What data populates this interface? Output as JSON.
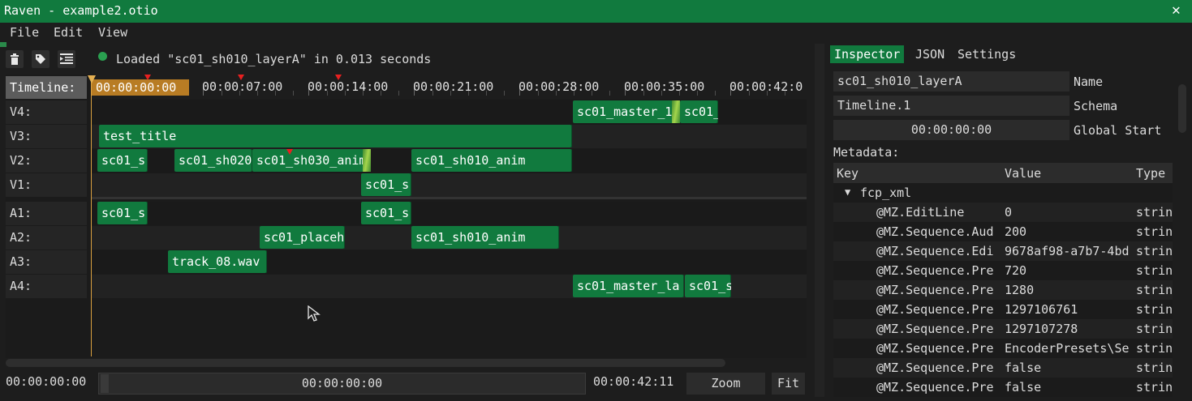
{
  "window": {
    "title": "Raven - example2.otio",
    "close_icon": "close-icon"
  },
  "menu": {
    "file": "File",
    "edit": "Edit",
    "view": "View"
  },
  "toolbar": {
    "delete_icon": "trash-icon",
    "tag_icon": "tag-icon",
    "indent_icon": "indent-icon",
    "status_message": "Loaded \"sc01_sh010_layerA\" in 0.013 seconds"
  },
  "timeline": {
    "label": "Timeline:",
    "current_time": "00:00:00:00",
    "ruler": [
      "00:00:07:00",
      "00:00:14:00",
      "00:00:21:00",
      "00:00:28:00",
      "00:00:35:00",
      "00:00:42:0"
    ],
    "tracks": [
      "V4:",
      "V3:",
      "V2:",
      "V1:",
      "A1:",
      "A2:",
      "A3:",
      "A4:"
    ],
    "clips": {
      "v4_1": "sc01_master_1",
      "v4_2": "sc01_",
      "v3_1": "test_title",
      "v2_1": "sc01_s",
      "v2_2": "sc01_sh020",
      "v2_3": "sc01_sh030_anim",
      "v2_4": "sc01_sh010_anim",
      "v1_1": "sc01_s",
      "a1_1": "sc01_s",
      "a1_2": "sc01_s",
      "a2_1": "sc01_placeh",
      "a2_2": "sc01_sh010_anim",
      "a3_1": "track_08.wav",
      "a4_1": "sc01_master_la",
      "a4_2": "sc01_s"
    }
  },
  "bottom_bar": {
    "start": "00:00:00:00",
    "slider": "00:00:00:00",
    "end": "00:00:42:11",
    "zoom": "Zoom",
    "fit": "Fit"
  },
  "inspector": {
    "tabs": [
      "Inspector",
      "JSON",
      "Settings"
    ],
    "fields": [
      {
        "value": "sc01_sh010_layerA",
        "label": "Name"
      },
      {
        "value": "Timeline.1",
        "label": "Schema"
      },
      {
        "value": "00:00:00:00",
        "label": "Global Start"
      }
    ],
    "metadata_label": "Metadata:",
    "columns": [
      "Key",
      "Value",
      "Type"
    ],
    "group": "fcp_xml",
    "rows": [
      {
        "key": "@MZ.EditLine",
        "value": "0",
        "type": "strin"
      },
      {
        "key": "@MZ.Sequence.Aud",
        "value": "200",
        "type": "strin"
      },
      {
        "key": "@MZ.Sequence.Edi",
        "value": "9678af98-a7b7-4bd",
        "type": "strin"
      },
      {
        "key": "@MZ.Sequence.Pre",
        "value": "720",
        "type": "strin"
      },
      {
        "key": "@MZ.Sequence.Pre",
        "value": "1280",
        "type": "strin"
      },
      {
        "key": "@MZ.Sequence.Pre",
        "value": "1297106761",
        "type": "strin"
      },
      {
        "key": "@MZ.Sequence.Pre",
        "value": "1297107278",
        "type": "strin"
      },
      {
        "key": "@MZ.Sequence.Pre",
        "value": "EncoderPresets\\Se",
        "type": "strin"
      },
      {
        "key": "@MZ.Sequence.Pre",
        "value": "false",
        "type": "strin"
      },
      {
        "key": "@MZ.Sequence.Pre",
        "value": "false",
        "type": "strin"
      }
    ]
  },
  "colors": {
    "accent": "#117a3e",
    "playhead": "#d9a040",
    "marker": "#e82020"
  }
}
